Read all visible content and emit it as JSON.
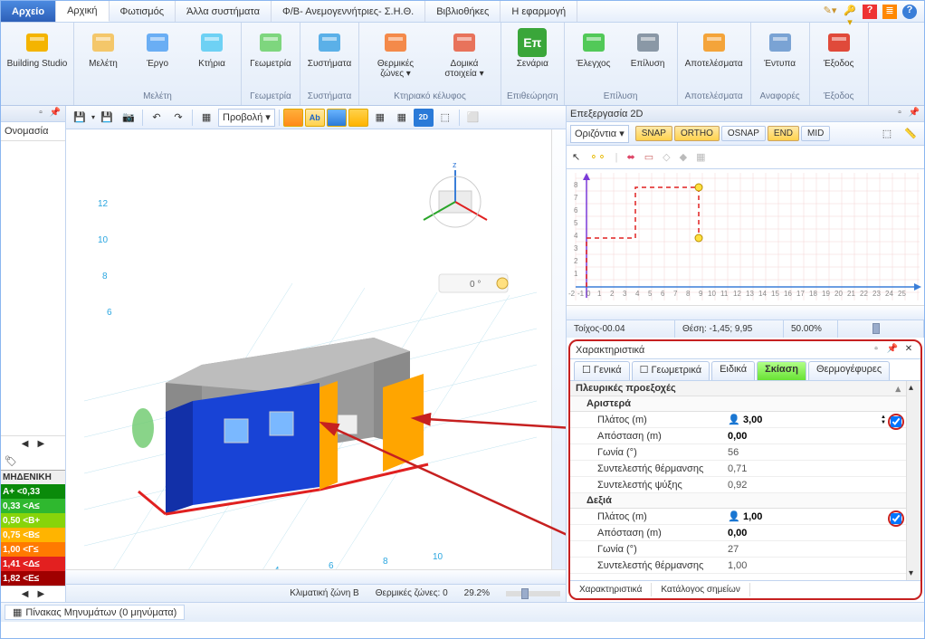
{
  "menu": {
    "file": "Αρχείο",
    "tabs": [
      "Αρχική",
      "Φωτισμός",
      "Άλλα συστήματα",
      "Φ/Β- Ανεμογεννήτριες- Σ.Η.Θ.",
      "Βιβλιοθήκες",
      "Η εφαρμογή"
    ]
  },
  "ribbon": {
    "groups": [
      {
        "title": "",
        "items": [
          {
            "label": "Building Studio",
            "icon": "building-studio-icon",
            "color": "#f4b400"
          }
        ]
      },
      {
        "title": "Μελέτη",
        "items": [
          {
            "label": "Μελέτη",
            "icon": "study-icon",
            "color": "#f4c76a"
          },
          {
            "label": "Έργο",
            "icon": "project-icon",
            "color": "#6aaef4"
          },
          {
            "label": "Κτήρια",
            "icon": "buildings-icon",
            "color": "#6ed1f4"
          }
        ]
      },
      {
        "title": "Γεωμετρία",
        "items": [
          {
            "label": "Γεωμετρία",
            "icon": "geometry-icon",
            "color": "#7ed67e"
          }
        ]
      },
      {
        "title": "Συστήματα",
        "items": [
          {
            "label": "Συστήματα",
            "icon": "systems-icon",
            "color": "#5bb0e8"
          }
        ]
      },
      {
        "title": "Κτηριακό κέλυφος",
        "items": [
          {
            "label": "Θερμικές ζώνες ▾",
            "icon": "zones-icon",
            "color": "#f48a4a"
          },
          {
            "label": "Δομικά στοιχεία ▾",
            "icon": "elements-icon",
            "color": "#e8735b"
          }
        ]
      },
      {
        "title": "Επιθεώρηση",
        "items": [
          {
            "label": "Σενάρια",
            "icon": "scenarios-icon",
            "color": "#3aa63a",
            "text": "Επ"
          }
        ]
      },
      {
        "title": "Επίλυση",
        "items": [
          {
            "label": "Έλεγχος",
            "icon": "check-icon",
            "color": "#52c958"
          },
          {
            "label": "Επίλυση",
            "icon": "solve-icon",
            "color": "#8a98a6"
          }
        ]
      },
      {
        "title": "Αποτελέσματα",
        "items": [
          {
            "label": "Αποτελέσματα",
            "icon": "results-icon",
            "color": "#f4a43a"
          }
        ]
      },
      {
        "title": "Αναφορές",
        "items": [
          {
            "label": "Έντυπα",
            "icon": "reports-icon",
            "color": "#7aa3d4"
          }
        ]
      },
      {
        "title": "Έξοδος",
        "items": [
          {
            "label": "Έξοδος",
            "icon": "exit-icon",
            "color": "#e04a3a"
          }
        ]
      }
    ]
  },
  "left": {
    "heading": "Ονομασία",
    "legend_title": "ΜΗΔΕΝΙΚΗ",
    "legend_rows": [
      {
        "label": "A+ <0,33",
        "bg": "#0a8a0a"
      },
      {
        "label": "0,33 <Α≤",
        "bg": "#2fb82f"
      },
      {
        "label": "0,50 <B+",
        "bg": "#88d40a"
      },
      {
        "label": "0,75 <B≤",
        "bg": "#ffb400"
      },
      {
        "label": "1,00 <Γ≤",
        "bg": "#ff7a00"
      },
      {
        "label": "1,41 <Δ≤",
        "bg": "#e32020"
      },
      {
        "label": "1,82 <E≤",
        "bg": "#a00000"
      }
    ]
  },
  "viewportToolbar": {
    "combo": "Προβολή ▾",
    "angle": "0 °"
  },
  "status3d": {
    "zone": "Κλιματική ζώνη B",
    "zones": "Θερμικές ζώνες: 0",
    "zoom": "29.2%"
  },
  "edit2d": {
    "title": "Επεξεργασία 2D",
    "orient": "Οριζόντια ▾",
    "snap_buttons": [
      {
        "label": "SNAP",
        "on": true
      },
      {
        "label": "ORTHO",
        "on": true
      },
      {
        "label": "OSNAP",
        "on": false
      },
      {
        "label": "END",
        "on": true
      },
      {
        "label": "MID",
        "on": false
      }
    ],
    "status": {
      "wall": "Τοίχος-00.04",
      "pos": "Θέση: -1,45; 9,95",
      "zoom": "50.00%"
    }
  },
  "props": {
    "title": "Χαρακτηριστικά",
    "tabs": [
      "Γενικά",
      "Γεωμετρικά",
      "Ειδικά",
      "Σκίαση",
      "Θερμογέφυρες"
    ],
    "active_tab": "Σκίαση",
    "section": "Πλευρικές προεξοχές",
    "left_group": "Αριστερά",
    "right_group": "Δεξιά",
    "rows_left": [
      {
        "k": "Πλάτος (m)",
        "v": "3,00",
        "bold": true,
        "person": true,
        "spin": true,
        "chk": true
      },
      {
        "k": "Απόσταση (m)",
        "v": "0,00",
        "bold": true
      },
      {
        "k": "Γωνία (°)",
        "v": "56"
      },
      {
        "k": "Συντελεστής θέρμανσης",
        "v": "0,71"
      },
      {
        "k": "Συντελεστής ψύξης",
        "v": "0,92"
      }
    ],
    "rows_right": [
      {
        "k": "Πλάτος (m)",
        "v": "1,00",
        "bold": true,
        "person": true,
        "chk": true
      },
      {
        "k": "Απόσταση (m)",
        "v": "0,00",
        "bold": true
      },
      {
        "k": "Γωνία (°)",
        "v": "27"
      },
      {
        "k": "Συντελεστής θέρμανσης",
        "v": "1,00"
      }
    ],
    "bottom_tabs": [
      "Χαρακτηριστικά",
      "Κατάλογος σημείων"
    ]
  },
  "footer": {
    "messages": "Πίνακας Μηνυμάτων (0 μηνύματα)"
  }
}
